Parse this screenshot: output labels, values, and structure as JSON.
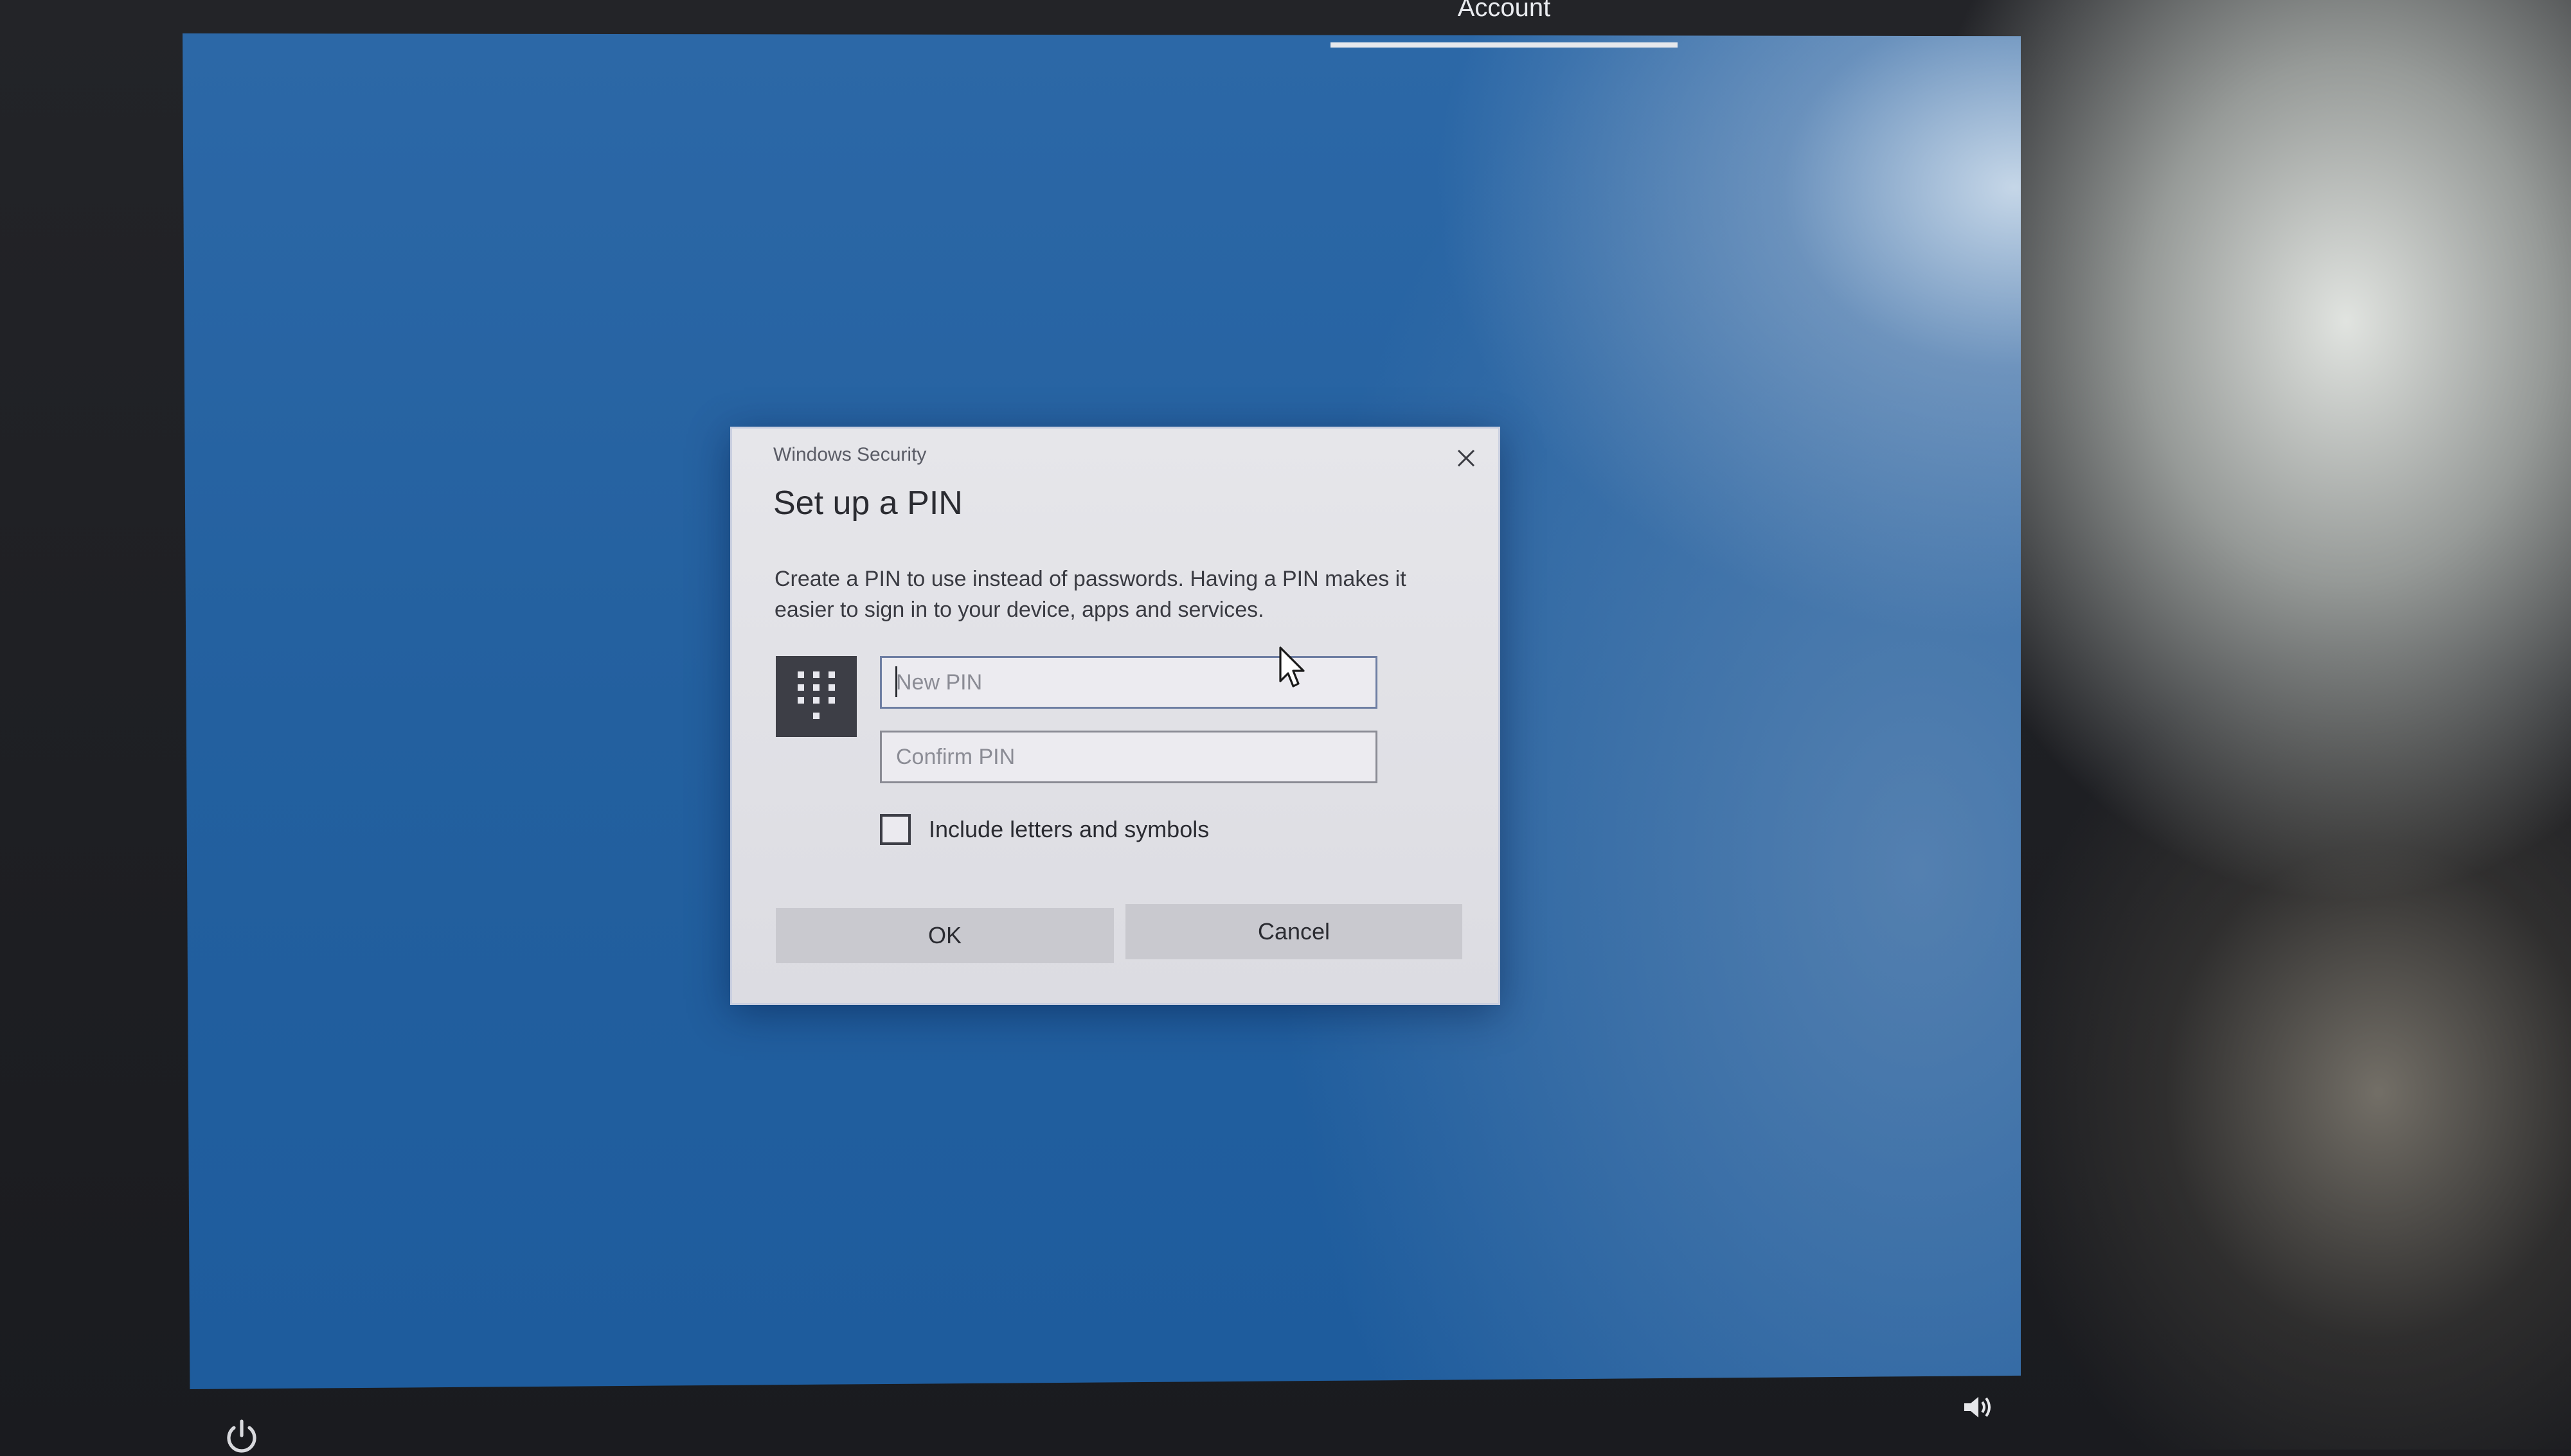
{
  "top_tab": {
    "label": "Account"
  },
  "dialog": {
    "source": "Windows Security",
    "title": "Set up a PIN",
    "description": "Create a PIN to use instead of passwords. Having a PIN makes it easier to sign in to your device, apps and services.",
    "fields": {
      "new_pin": {
        "placeholder": "New PIN",
        "value": ""
      },
      "confirm_pin": {
        "placeholder": "Confirm PIN",
        "value": ""
      }
    },
    "checkbox": {
      "label": "Include letters and symbols",
      "checked": false
    },
    "buttons": {
      "ok": "OK",
      "cancel": "Cancel"
    },
    "icons": {
      "close": "close-icon",
      "keypad": "keypad-icon"
    }
  },
  "system_tray": {
    "icons": [
      "power-icon",
      "volume-icon"
    ]
  },
  "colors": {
    "desktop_blue": "#2563a2",
    "dialog_bg": "#e3e3e8",
    "button_bg": "#c9c9cf",
    "keypad_tile": "#3d3e46"
  }
}
